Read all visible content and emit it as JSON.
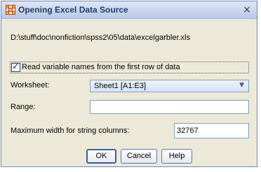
{
  "dialog": {
    "title": "Opening Excel Data Source",
    "close_glyph": "×",
    "file_path": "D:\\stuff\\doc\\nonfiction\\spss2\\05\\data\\excelgarbler.xls"
  },
  "options": {
    "read_names_label": "Read variable names from the first row of data",
    "read_names_checked": true,
    "checkmark_glyph": "✓"
  },
  "worksheet": {
    "label": "Worksheet:",
    "value": "Sheet1 [A1:E3]",
    "arrow_glyph": "▼"
  },
  "range": {
    "label": "Range:",
    "value": ""
  },
  "max_width": {
    "label": "Maximum width for string columns:",
    "value": "32767"
  },
  "buttons": {
    "ok": "OK",
    "cancel": "Cancel",
    "help": "Help"
  },
  "icons": {
    "app": "spss-app-icon",
    "close": "close-icon",
    "check": "check-icon",
    "dropdown": "chevron-down-icon"
  }
}
